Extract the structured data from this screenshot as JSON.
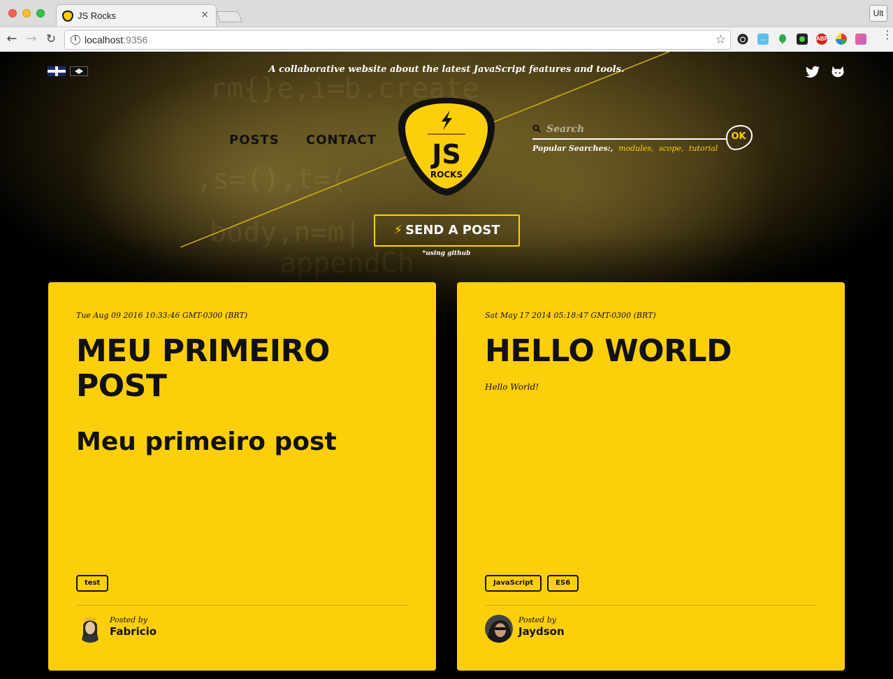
{
  "browser": {
    "tab_title": "JS Rocks",
    "tab_close": "×",
    "url_host": "localhost",
    "url_port": ":9356",
    "ult_button": "Ult",
    "extensions": [
      "github-icon",
      "chat-bubble-icon",
      "leaf-icon",
      "green-dot-icon",
      "adblock-icon",
      "pinwheel-icon",
      "gradient-square-icon"
    ],
    "adblock_label": "ABP"
  },
  "header": {
    "tagline": "A collaborative website about the latest JavaScript features and tools.",
    "languages": [
      "english-flag-icon",
      "brazil-flag-icon"
    ],
    "social": [
      "twitter-icon",
      "github-icon"
    ]
  },
  "nav": {
    "posts": "POSTS",
    "contact": "CONTACT"
  },
  "logo": {
    "line1": "JS",
    "line2": "ROCKS"
  },
  "search": {
    "placeholder": "Search",
    "ok_label": "OK",
    "popular_label": "Popular Searches:,",
    "popular_terms": [
      "modules,",
      "scope,",
      "tutorial"
    ]
  },
  "send_post": {
    "label": "SEND A POST",
    "note": "*using github"
  },
  "posts": [
    {
      "date": "Tue Aug 09 2016 10:33:46 GMT-0300 (BRT)",
      "title": "MEU PRIMEIRO POST",
      "subtitle": "Meu primeiro post",
      "excerpt": "",
      "tags": [
        "test"
      ],
      "posted_by_label": "Posted by",
      "author": "Fabricio"
    },
    {
      "date": "Sat May 17 2014 05:18:47 GMT-0300 (BRT)",
      "title": "HELLO WORLD",
      "subtitle": "",
      "excerpt": "Hello World!",
      "tags": [
        "JavaScript",
        "ES6"
      ],
      "posted_by_label": "Posted by",
      "author": "Jaydson"
    }
  ],
  "colors": {
    "accent": "#fdcf0b",
    "text_dark": "#111111"
  }
}
